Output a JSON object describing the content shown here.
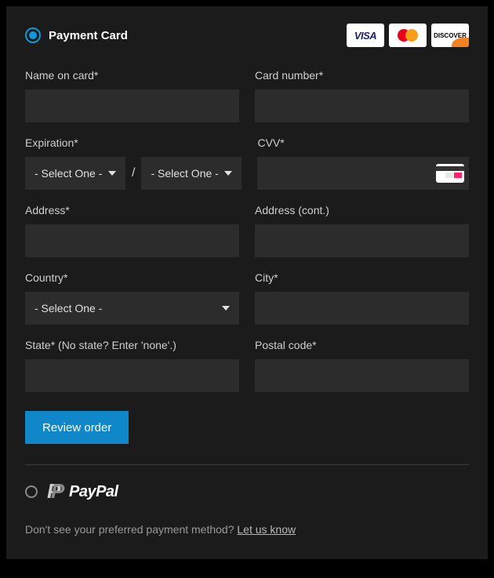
{
  "header": {
    "title": "Payment Card",
    "cards": {
      "visa": "VISA",
      "mastercard": "MasterCard",
      "discover": "DISCOVER"
    }
  },
  "fields": {
    "name_label": "Name on card*",
    "card_number_label": "Card number*",
    "expiration_label": "Expiration*",
    "exp_month_selected": "- Select One -",
    "exp_year_selected": "- Select One -",
    "exp_separator": "/",
    "cvv_label": "CVV*",
    "address_label": "Address*",
    "address2_label": "Address (cont.)",
    "country_label": "Country*",
    "country_selected": "- Select One -",
    "city_label": "City*",
    "state_label": "State* (No state? Enter 'none'.)",
    "postal_label": "Postal code*"
  },
  "buttons": {
    "review": "Review order"
  },
  "paypal": {
    "label": "PayPal"
  },
  "footer": {
    "text": "Don't see your preferred payment method? ",
    "link": "Let us know"
  }
}
